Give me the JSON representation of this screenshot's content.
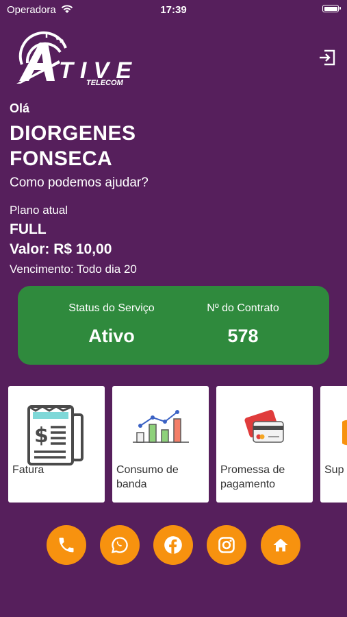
{
  "status_bar": {
    "carrier": "Operadora",
    "time": "17:39"
  },
  "header": {
    "logo_alt": "ATIVE TELECOM",
    "logout_icon": "logout-icon"
  },
  "user": {
    "greeting": "Olá",
    "name": "DIORGENES FONSECA",
    "help_text": "Como podemos ajudar?"
  },
  "plan": {
    "label": "Plano atual",
    "name": "FULL",
    "value": "Valor: R$ 10,00",
    "due": "Vencimento: Todo dia 20"
  },
  "service": {
    "status_title": "Status do Serviço",
    "status_value": "Ativo",
    "contract_title": "Nº do Contrato",
    "contract_value": "578",
    "color": "#2f8a3d"
  },
  "tiles": [
    {
      "label": "Fatura",
      "icon": "invoice-icon"
    },
    {
      "label": "Consumo de banda",
      "icon": "bar-chart-icon"
    },
    {
      "label": "Promessa de pagamento",
      "icon": "credit-card-icon"
    },
    {
      "label": "Sup",
      "icon": "support-icon"
    }
  ],
  "socials": [
    {
      "name": "phone",
      "icon": "phone-icon"
    },
    {
      "name": "whatsapp",
      "icon": "whatsapp-icon"
    },
    {
      "name": "facebook",
      "icon": "facebook-icon"
    },
    {
      "name": "instagram",
      "icon": "instagram-icon"
    },
    {
      "name": "home",
      "icon": "home-icon"
    }
  ],
  "colors": {
    "background": "#561f5c",
    "accent": "#f7920f",
    "status_card": "#2f8a3d",
    "tile": "#ffffff"
  }
}
